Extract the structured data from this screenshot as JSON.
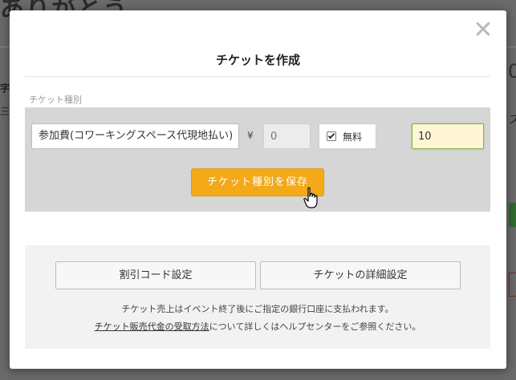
{
  "background_page": {
    "title_fragment": "ありがとう",
    "frag_left_1": "字",
    "frag_left_2": "三",
    "frag_right_1": "0",
    "frag_right_2": "ス"
  },
  "modal": {
    "title": "チケットを作成",
    "close_symbol": "✕",
    "section_label": "チケット種別",
    "ticket": {
      "name_value": "参加費(コワーキングスペース代現地払い)",
      "currency_symbol": "¥",
      "price_placeholder": "0",
      "free_checked": true,
      "free_label": "無料",
      "quantity_value": "10",
      "save_button_label": "チケット種別を保存"
    },
    "actions": {
      "discount_code_label": "割引コード設定",
      "ticket_detail_label": "チケットの詳細設定"
    },
    "notes": {
      "line1": "チケット売上はイベント終了後にご指定の銀行口座に支払われます。",
      "line2_link": "チケット販売代金の受取方法",
      "line2_rest": "について詳しくはヘルプセンターをご参照ください。"
    },
    "colors": {
      "accent": "#f3a918",
      "focus_border": "#7fb24e"
    }
  }
}
